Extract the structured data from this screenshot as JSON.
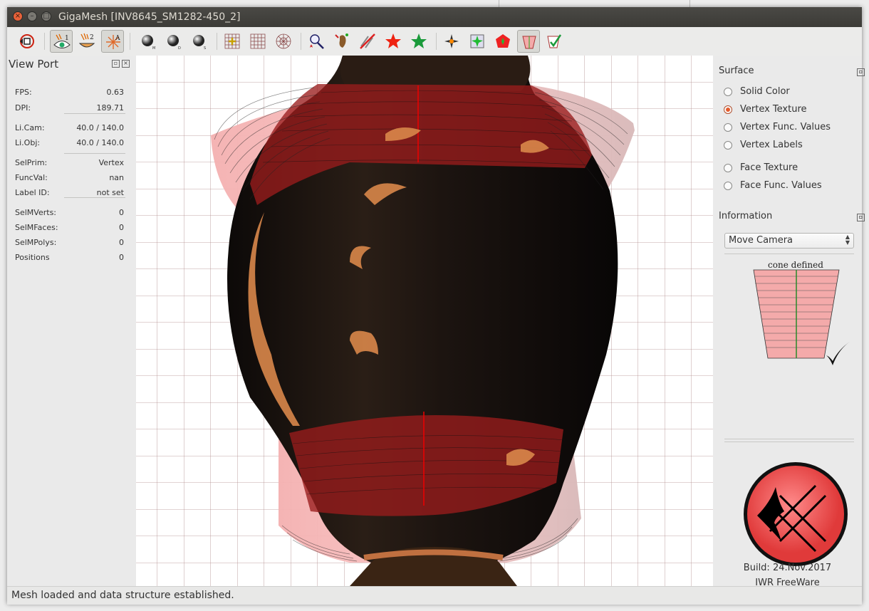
{
  "window": {
    "title": "GigaMesh [INV8645_SM1282-450_2]"
  },
  "toolbar": {
    "icons": [
      "rotate-view-icon",
      "light1-eye-icon",
      "light2-bowl-icon",
      "ambient-light-icon",
      "sphere-m-icon",
      "sphere-d-icon",
      "sphere-s-icon",
      "grid-cross-icon",
      "grid-icon",
      "polar-grid-icon",
      "select-star-icon",
      "mesh-wand-icon",
      "no-select-icon",
      "red-star-icon",
      "green-star-icon",
      "spark-icon",
      "green-splash-icon",
      "red-splash-icon",
      "cone-icon",
      "checkmark-icon"
    ],
    "sphere_letters": [
      "M",
      "D",
      "S"
    ],
    "light_labels": [
      "1",
      "2",
      "A"
    ]
  },
  "viewport_panel": {
    "title": "View Port",
    "rows": [
      {
        "label": "FPS:",
        "value": "0.63"
      },
      {
        "label": "DPI:",
        "value": "189.71"
      },
      {
        "label": "Li.Cam:",
        "value": "40.0 / 140.0"
      },
      {
        "label": "Li.Obj:",
        "value": "40.0 / 140.0"
      },
      {
        "label": "SelPrim:",
        "value": "Vertex"
      },
      {
        "label": "FuncVal:",
        "value": "nan"
      },
      {
        "label": "Label ID:",
        "value": "not set"
      },
      {
        "label": "SelMVerts:",
        "value": "0"
      },
      {
        "label": "SelMFaces:",
        "value": "0"
      },
      {
        "label": "SelMPolys:",
        "value": "0"
      },
      {
        "label": "Positions",
        "value": "0"
      }
    ]
  },
  "surface": {
    "title": "Surface",
    "options": [
      {
        "label": "Solid Color",
        "selected": false
      },
      {
        "label": "Vertex Texture",
        "selected": true
      },
      {
        "label": "Vertex Func. Values",
        "selected": false
      },
      {
        "label": "Vertex Labels",
        "selected": false
      },
      {
        "label": "Face Texture",
        "selected": false
      },
      {
        "label": "Face Func. Values",
        "selected": false
      }
    ]
  },
  "information": {
    "title": "Information",
    "mode_select": "Move Camera",
    "cone_label": "cone defined",
    "build": "Build: 24.Nov.2017",
    "license": "IWR FreeWare"
  },
  "status": {
    "message": "Mesh loaded and data structure established."
  },
  "colors": {
    "accent": "#e55b2c",
    "cone_fill": "#f4aaaa",
    "logo_red": "#f06262"
  }
}
